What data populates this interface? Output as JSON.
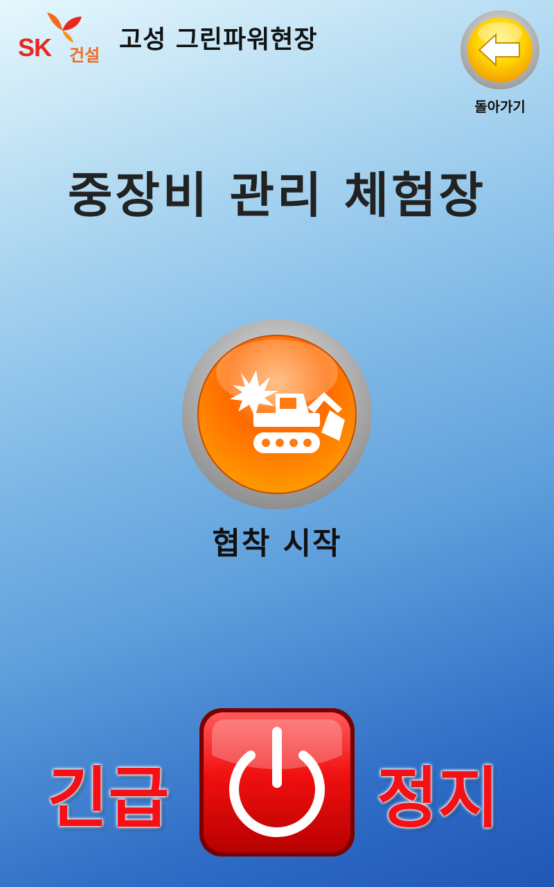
{
  "brand": {
    "logo_text": "SK",
    "logo_sub": "건설",
    "colors": {
      "red": "#e8281f",
      "orange": "#f26b1d"
    }
  },
  "header": {
    "site_title": "고성 그린파워현장",
    "back_label": "돌아가기",
    "back_icon": "arrow-left-icon"
  },
  "main": {
    "title": "중장비 관리 체험장",
    "action_label": "협착 시작",
    "action_icon": "excavator-collision-icon"
  },
  "emergency": {
    "left_text": "긴급",
    "right_text": "정지",
    "icon": "power-icon",
    "color": "#f41014"
  }
}
